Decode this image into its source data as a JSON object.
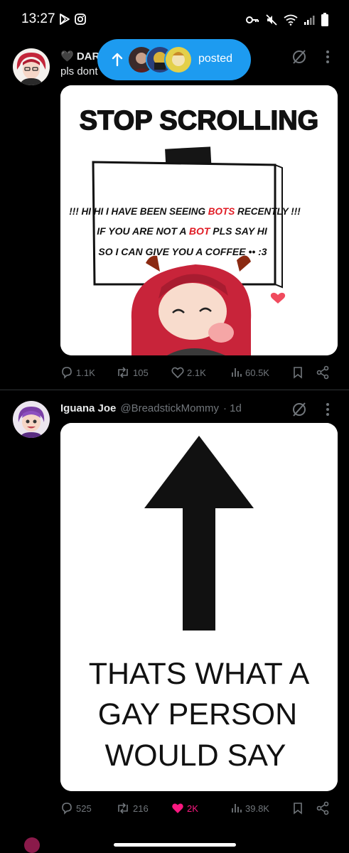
{
  "status_bar": {
    "time": "13:27",
    "left_icons": [
      "play-store-icon",
      "instagram-icon"
    ],
    "right_icons": [
      "key-icon",
      "mute-icon",
      "wifi-icon",
      "signal-icon",
      "battery-icon"
    ]
  },
  "new_posts_pill": {
    "label": "posted",
    "icon": "arrow-up-icon"
  },
  "posts": [
    {
      "name": "🖤 DAR",
      "handle": "",
      "time": "",
      "text": "pls dont",
      "meme": {
        "headline": "STOP SCROLLING",
        "line1_a": "!!! HI HI I HAVE BEEN SEEING ",
        "line1_b": "BOTS",
        "line1_c": " RECENTLY !!!",
        "line2_a": "IF YOU ARE NOT A ",
        "line2_b": "BOT",
        "line2_c": " PLS SAY HI",
        "line3": "SO I CAN GIVE YOU A COFFEE •• :3"
      },
      "actions": {
        "replies": "1.1K",
        "reposts": "105",
        "likes": "2.1K",
        "views": "60.5K",
        "liked": false
      }
    },
    {
      "name": "Iguana Joe",
      "handle": "@BreadstickMommy",
      "time": "· 1d",
      "text": "",
      "meme": {
        "line1": "THATS WHAT A",
        "line2": "GAY PERSON",
        "line3": "WOULD SAY"
      },
      "actions": {
        "replies": "525",
        "reposts": "216",
        "likes": "2K",
        "views": "39.8K",
        "liked": true
      }
    }
  ],
  "colors": {
    "background": "#000000",
    "accent": "#1d9bf0",
    "like": "#f91880",
    "muted": "#71767b",
    "text": "#e7e9ea"
  }
}
